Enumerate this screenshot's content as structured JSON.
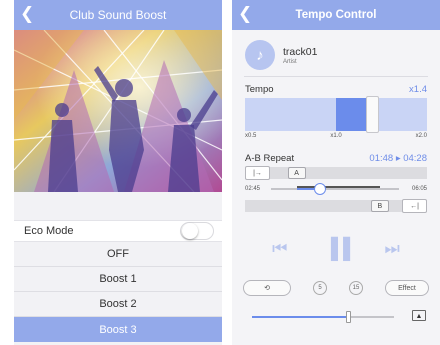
{
  "left_screen": {
    "title": "Club Sound Boost",
    "eco_mode": {
      "label": "Eco Mode",
      "enabled": false
    },
    "boost_options": [
      "OFF",
      "Boost 1",
      "Boost 2",
      "Boost 3"
    ],
    "selected_option": "Boost 3"
  },
  "right_screen": {
    "title": "Tempo Control",
    "track": {
      "name": "track01",
      "artist": "Artist",
      "artwork_icon": "music-note-icon"
    },
    "tempo": {
      "label": "Tempo",
      "value_text": "x1.4",
      "value": 1.4,
      "ticks": [
        "x0.5",
        "x1.0",
        "x2.0"
      ]
    },
    "ab_repeat": {
      "label": "A-B Repeat",
      "range_text": "01:48 ▸ 04:28",
      "a_marker": "A",
      "b_marker": "B",
      "position_start": "02:45",
      "position_end": "06:05",
      "position_fraction": 0.38,
      "a_fraction": 0.2,
      "b_fraction": 0.85
    },
    "transport": {
      "prev_icon": "previous-track-icon",
      "pause_icon": "pause-icon",
      "next_icon": "next-track-icon"
    },
    "tools": {
      "loop_icon": "loop-icon",
      "rewind_icon": "rewind-5-icon",
      "forward_icon": "forward-15-icon",
      "rewind_label": "5",
      "forward_label": "15",
      "effect_label": "Effect"
    },
    "volume": {
      "level": 0.68,
      "airplay_icon": "airplay-icon"
    }
  },
  "colors": {
    "accent": "#93a9ea",
    "accent_dark": "#6b8ceb",
    "value_text": "#6f8de8"
  }
}
